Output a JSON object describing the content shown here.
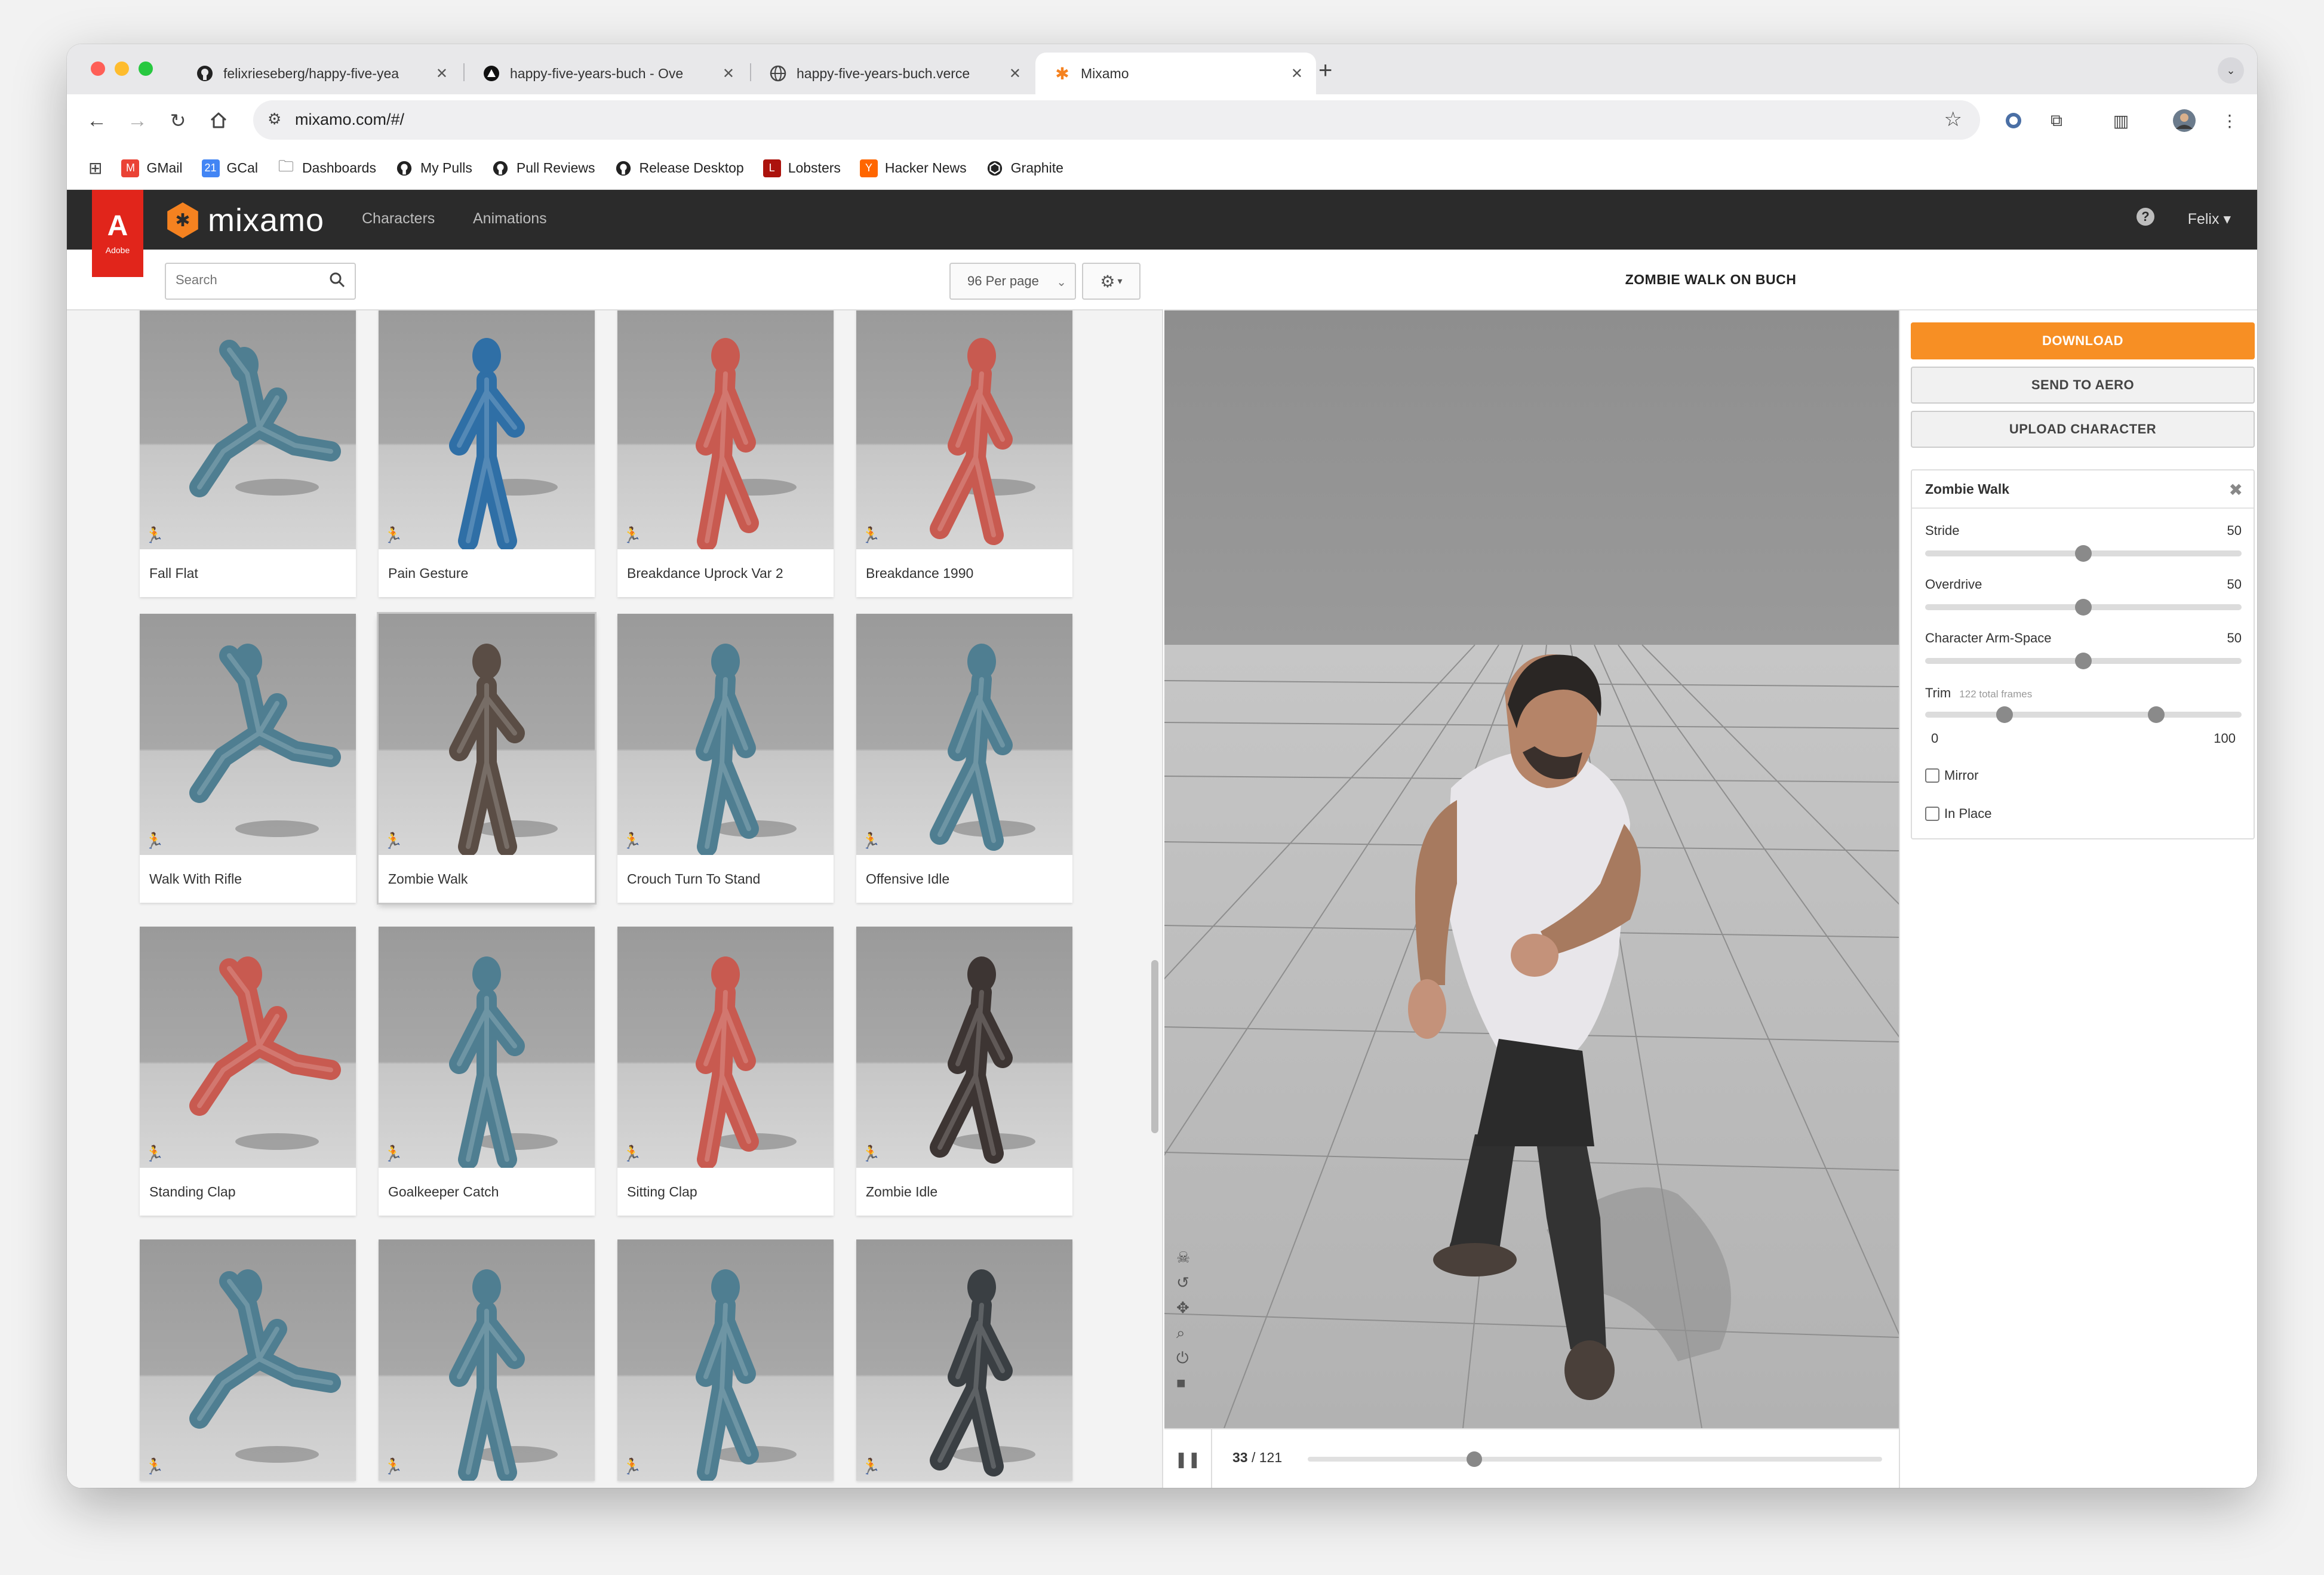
{
  "browser": {
    "tabs": [
      {
        "title": "felixrieseberg/happy-five-yea",
        "icon": "github-icon"
      },
      {
        "title": "happy-five-years-buch - Ove",
        "icon": "vercel-icon"
      },
      {
        "title": "happy-five-years-buch.verce",
        "icon": "globe-icon"
      },
      {
        "title": "Mixamo",
        "icon": "mixamo-icon"
      }
    ],
    "url": "mixamo.com/#/",
    "bookmarks": [
      {
        "label": "GMail",
        "icon": "gmail-icon",
        "color": "#ea4335"
      },
      {
        "label": "GCal",
        "icon": "calendar-icon",
        "color": "#4285f4"
      },
      {
        "label": "Dashboards",
        "icon": "folder-icon",
        "color": ""
      },
      {
        "label": "My Pulls",
        "icon": "github-icon",
        "color": "#111111"
      },
      {
        "label": "Pull Reviews",
        "icon": "github-icon",
        "color": "#111111"
      },
      {
        "label": "Release Desktop",
        "icon": "github-icon",
        "color": "#111111"
      },
      {
        "label": "Lobsters",
        "icon": "lobsters-icon",
        "color": "#ac130d"
      },
      {
        "label": "Hacker News",
        "icon": "hacker-news-icon",
        "color": "#ff6600"
      },
      {
        "label": "Graphite",
        "icon": "graphite-icon",
        "color": "#111111"
      }
    ]
  },
  "app": {
    "adobe_label": "Adobe",
    "logo_text": "mixamo",
    "nav": [
      "Characters",
      "Animations"
    ],
    "help_icon": "?",
    "user": "Felix",
    "accent": "#f78f24"
  },
  "library": {
    "search_placeholder": "Search",
    "per_page": "96 Per page",
    "cards": [
      {
        "name": "Fall Flat",
        "color": "#4f7e91"
      },
      {
        "name": "Pain Gesture",
        "color": "#2f6fa6"
      },
      {
        "name": "Breakdance Uprock Var 2",
        "color": "#c85a50"
      },
      {
        "name": "Breakdance 1990",
        "color": "#c85a50"
      },
      {
        "name": "Walk With Rifle",
        "color": "#4f7e91"
      },
      {
        "name": "Zombie Walk",
        "color": "#5a4d45"
      },
      {
        "name": "Crouch Turn To Stand",
        "color": "#4f7e91"
      },
      {
        "name": "Offensive Idle",
        "color": "#4f7e91"
      },
      {
        "name": "Standing Clap",
        "color": "#c85a50"
      },
      {
        "name": "Goalkeeper Catch",
        "color": "#4f7e91"
      },
      {
        "name": "Sitting Clap",
        "color": "#c85a50"
      },
      {
        "name": "Zombie Idle",
        "color": "#3d3533"
      },
      {
        "name": "",
        "color": "#4f7e91"
      },
      {
        "name": "",
        "color": "#4f7e91"
      },
      {
        "name": "",
        "color": "#4f7e91"
      },
      {
        "name": "",
        "color": "#3a3f43"
      }
    ],
    "selected_index": 5
  },
  "preview": {
    "title": "ZOMBIE WALK ON BUCH",
    "frame_current": "33",
    "frame_total": "/ 121",
    "progress": 0.29,
    "controls": [
      "skull-icon",
      "reset-icon",
      "move-icon",
      "zoom-icon",
      "power-icon",
      "camera-icon"
    ]
  },
  "sidebar": {
    "download": "DOWNLOAD",
    "send_to_aero": "SEND TO AERO",
    "upload_character": "UPLOAD CHARACTER",
    "animation_name": "Zombie Walk",
    "params": [
      {
        "label": "Stride",
        "value": "50",
        "level": 0.5
      },
      {
        "label": "Overdrive",
        "value": "50",
        "level": 0.5
      },
      {
        "label": "Character Arm-Space",
        "value": "50",
        "level": 0.5
      }
    ],
    "trim": {
      "label": "Trim",
      "note": "122 total frames",
      "min": "0",
      "max": "100",
      "start": 0.25,
      "end": 0.73
    },
    "mirror": "Mirror",
    "in_place": "In Place"
  }
}
